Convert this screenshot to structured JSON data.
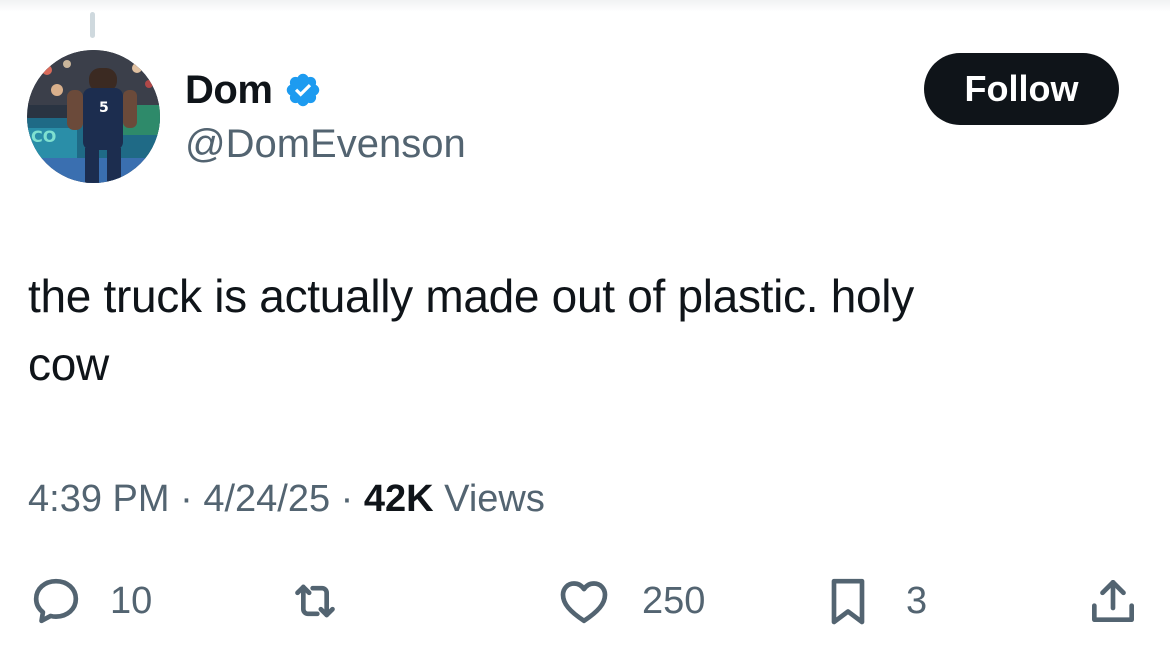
{
  "author": {
    "display_name": "Dom",
    "handle": "@DomEvenson",
    "verified_icon": "verified-badge-icon",
    "avatar_icon": "basketball-player-avatar"
  },
  "follow_button": {
    "label": "Follow"
  },
  "tweet": {
    "text": "the truck is actually made out of plastic. holy\ncow"
  },
  "meta": {
    "time": "4:39 PM",
    "date": "4/24/25",
    "separator": "·",
    "views_count": "42K",
    "views_label": "Views"
  },
  "actions": {
    "reply_count": "10",
    "like_count": "250",
    "bookmark_count": "3"
  },
  "colors": {
    "text": "#0f1419",
    "secondary": "#536471",
    "verified": "#1d9bf0",
    "follow_bg": "#0f1419"
  }
}
